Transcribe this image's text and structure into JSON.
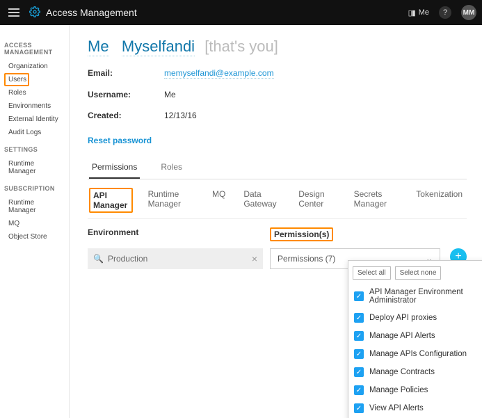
{
  "topbar": {
    "app_name": "Access Management",
    "me_label": "Me",
    "avatar_initials": "MM"
  },
  "sidebar": {
    "section1": "ACCESS MANAGEMENT",
    "items1": [
      "Organization",
      "Users",
      "Roles",
      "Environments",
      "External Identity",
      "Audit Logs"
    ],
    "section2": "SETTINGS",
    "items2": [
      "Runtime Manager"
    ],
    "section3": "SUBSCRIPTION",
    "items3": [
      "Runtime Manager",
      "MQ",
      "Object Store"
    ]
  },
  "breadcrumb": {
    "first": "Me",
    "second": "Myselfandi",
    "suffix": "[that's you]"
  },
  "details": {
    "email_label": "Email:",
    "email_value": "memyselfandi@example.com",
    "username_label": "Username:",
    "username_value": "Me",
    "created_label": "Created:",
    "created_value": "12/13/16"
  },
  "reset_password": "Reset password",
  "tabs_primary": {
    "permissions": "Permissions",
    "roles": "Roles"
  },
  "tabs_secondary": [
    "API Manager",
    "Runtime Manager",
    "MQ",
    "Data Gateway",
    "Design Center",
    "Secrets Manager",
    "Tokenization"
  ],
  "columns": {
    "env": "Environment",
    "perm": "Permission(s)"
  },
  "env_input": {
    "value": "Production"
  },
  "perm_select": {
    "label": "Permissions (7)"
  },
  "dropdown": {
    "select_all": "Select all",
    "select_none": "Select none",
    "options": [
      "API Manager Environment Administrator",
      "Deploy API proxies",
      "Manage API Alerts",
      "Manage APIs Configuration",
      "Manage Contracts",
      "Manage Policies",
      "View API Alerts"
    ]
  }
}
